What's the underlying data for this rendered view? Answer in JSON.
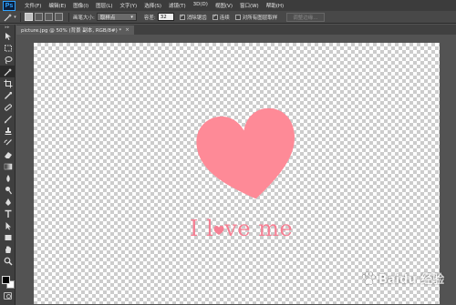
{
  "app": {
    "logo": "Ps"
  },
  "menu": [
    "文件(F)",
    "编辑(E)",
    "图像(I)",
    "图层(L)",
    "文字(Y)",
    "选择(S)",
    "滤镜(T)",
    "3D(D)",
    "视图(V)",
    "窗口(W)",
    "帮助(H)"
  ],
  "options": {
    "brush_size_label": "画笔大小:",
    "sample_label": "取样点",
    "tolerance_label": "容差:",
    "tolerance_value": "32",
    "antialias_label": "消除锯齿",
    "antialias_checked": true,
    "contiguous_label": "连续",
    "contiguous_checked": true,
    "sample_all_layers_label": "对所有图层取样",
    "sample_all_layers_checked": false,
    "refine_edge_label": "调整边缘..."
  },
  "document": {
    "tab_title": "picture.jpg @ 50% (背景 副本, RGB/8#) *",
    "close_glyph": "×"
  },
  "tools": [
    "move-icon",
    "marquee-icon",
    "lasso-icon",
    "magic-wand-icon",
    "crop-icon",
    "eyedropper-icon",
    "healing-icon",
    "brush-icon",
    "clone-stamp-icon",
    "history-brush-icon",
    "eraser-icon",
    "gradient-icon",
    "blur-icon",
    "dodge-icon",
    "pen-icon",
    "type-icon",
    "path-selection-icon",
    "shape-icon",
    "hand-icon",
    "zoom-icon"
  ],
  "canvas": {
    "text_before": "I l",
    "text_after": "ve me",
    "heart_color": "#fe8a97",
    "text_color": "#f57f93"
  },
  "watermark": {
    "text": "Baidu 经验"
  },
  "colors": {
    "foreground": "#000000",
    "background": "#ffffff",
    "accent": "#2fa3ff"
  }
}
